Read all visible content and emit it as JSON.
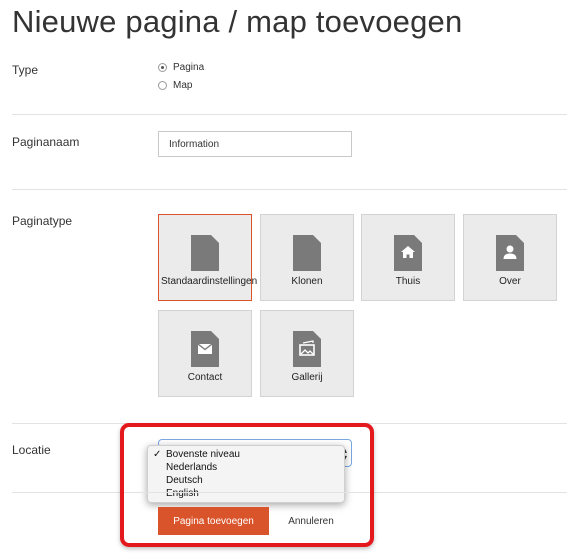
{
  "page": {
    "title": "Nieuwe pagina / map toevoegen"
  },
  "type_field": {
    "label": "Type",
    "options": [
      {
        "label": "Pagina",
        "checked": true
      },
      {
        "label": "Map",
        "checked": false
      }
    ]
  },
  "page_name": {
    "label": "Paginanaam",
    "value": "Information"
  },
  "page_type": {
    "label": "Paginatype",
    "tiles": [
      {
        "label": "Standaardinstellingen",
        "icon": "document-icon",
        "selected": true
      },
      {
        "label": "Klonen",
        "icon": "document-icon",
        "selected": false
      },
      {
        "label": "Thuis",
        "icon": "home-icon",
        "selected": false
      },
      {
        "label": "Over",
        "icon": "person-icon",
        "selected": false
      },
      {
        "label": "Contact",
        "icon": "envelope-icon",
        "selected": false
      },
      {
        "label": "Gallerij",
        "icon": "image-icon",
        "selected": false
      }
    ]
  },
  "location": {
    "label": "Locatie",
    "options": [
      "Bovenste niveau",
      "Nederlands",
      "Deutsch",
      "English"
    ],
    "selected": "Bovenste niveau",
    "check_mark": "✓"
  },
  "actions": {
    "submit_label": "Pagina toevoegen",
    "cancel_label": "Annuleren"
  },
  "colors": {
    "accent": "#d9542b",
    "highlight": "#e3191d",
    "tile_bg": "#ebebeb",
    "icon_gray": "#7a7a7a"
  }
}
